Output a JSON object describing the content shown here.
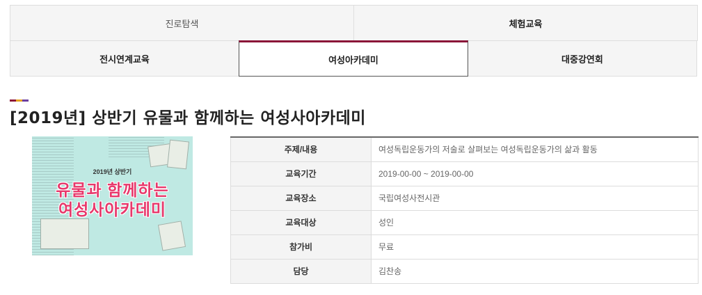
{
  "tabs": {
    "row1": [
      {
        "label": "진로탐색"
      },
      {
        "label": "체험교육"
      }
    ],
    "row2": [
      {
        "label": "전시연계교육"
      },
      {
        "label": "여성아카데미"
      },
      {
        "label": "대중강연회"
      }
    ]
  },
  "accent_colors": [
    "#8b1538",
    "#e7a31f",
    "#6b3fa0"
  ],
  "program": {
    "title": "[2019년] 상반기 유물과 함께하는 여성사아카데미",
    "poster": {
      "subtitle": "2019년 상반기",
      "line1": "유물과 함께하는",
      "line2": "여성사아카데미"
    }
  },
  "details": [
    {
      "label": "주제/내용",
      "value": "여성독립운동가의 저술로 살펴보는 여성독립운동가의 삶과 활동"
    },
    {
      "label": "교육기간",
      "value": "2019-00-00 ~ 2019-00-00"
    },
    {
      "label": "교육장소",
      "value": "국립여성사전시관"
    },
    {
      "label": "교육대상",
      "value": "성인"
    },
    {
      "label": "참가비",
      "value": "무료"
    },
    {
      "label": "담당",
      "value": "김찬송"
    }
  ]
}
